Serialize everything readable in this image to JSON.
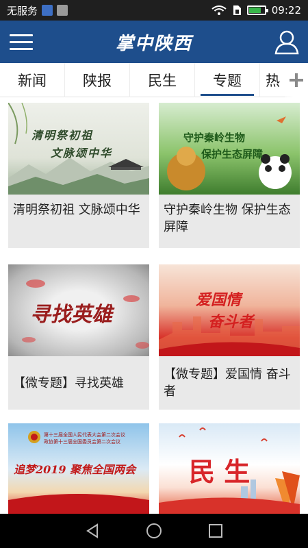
{
  "status_bar": {
    "carrier": "无服务",
    "time": "09:22",
    "battery_level": 0.8,
    "icons": [
      "notification-app-icon",
      "image-icon",
      "wifi-icon",
      "sim-icon",
      "battery-icon"
    ]
  },
  "header": {
    "title": "掌中陕西",
    "menu_icon": "hamburger-menu-icon",
    "user_icon": "user-icon",
    "background_color": "#1e4e8c"
  },
  "tabs": {
    "items": [
      {
        "label": "新闻"
      },
      {
        "label": "陕报"
      },
      {
        "label": "民生"
      },
      {
        "label": "专题"
      },
      {
        "label": "热"
      }
    ],
    "active_index": 3,
    "add_icon": "plus-icon"
  },
  "cards": [
    {
      "caption": "清明祭初祖 文脉颂中华",
      "thumb_text": [
        "清明祭初祖",
        "文脉颂中华"
      ],
      "thumb_theme": "ink-landscape"
    },
    {
      "caption": "守护秦岭生物 保护生态屏障",
      "thumb_text": [
        "守护秦岭生物",
        "保护生态屏障"
      ],
      "thumb_theme": "forest-wildlife"
    },
    {
      "caption": "【微专题】寻找英雄",
      "thumb_text": [
        "寻找英雄"
      ],
      "thumb_theme": "grey-clouds"
    },
    {
      "caption": "【微专题】爱国情 奋斗者",
      "thumb_text": [
        "爱国情",
        "奋斗者"
      ],
      "thumb_theme": "red-city"
    },
    {
      "caption": "",
      "thumb_text": [
        "第十三届全国人民代表大会第二次会议",
        "政协第十三届全国委员会第二次会议",
        "追梦2019 聚焦全国两会"
      ],
      "thumb_theme": "sky-red"
    },
    {
      "caption": "",
      "thumb_text": [
        "民 生"
      ],
      "thumb_theme": "sky-red-autumn"
    }
  ],
  "nav_bar": {
    "icons": [
      "back-icon",
      "home-icon",
      "recents-icon"
    ]
  }
}
